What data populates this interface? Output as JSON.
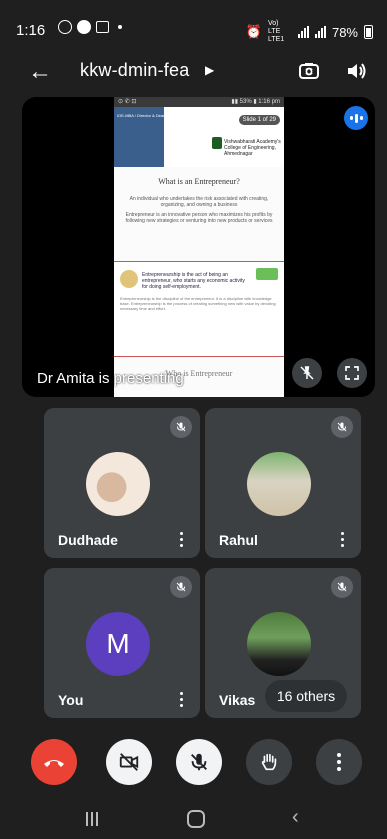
{
  "status_bar": {
    "time": "1:16",
    "network": "Vo) LTE LTE1",
    "battery": "78%"
  },
  "top_bar": {
    "meeting_title": "kkw-dmin-fea",
    "back_icon": "arrow-left-icon",
    "switch_camera_icon": "switch-camera-icon",
    "speaker_icon": "speaker-icon"
  },
  "presentation": {
    "presenter_label": "Dr Amita is presenting",
    "slide_counter": "Slide 1 of 29",
    "slide_header_text": "IOE-MBA / Director & Dean / 23rd February 2021",
    "college_name": "Vishwabharati Academy's College of Engineering, Ahmednagar",
    "slide1_title": "What is an Entrepreneur?",
    "slide1_point1": "An individual who undertakes the risk associated with creating, organizing, and owning a business",
    "slide1_point2": "Entrepreneur is an innovative person who maximizes his profits by following new strategies or venturing into new products or services",
    "slide2_bold": "Entrepreneurship is the act of being an entrepreneur, who starts any economic activity for doing self-employment.",
    "slide2_para": "Entrepreneurship is the discipline of the entrepreneur. It is a discipline with knowledge base. Entrepreneurship is the process of creating something new with value by devoting necessary time and effort.",
    "slide3_title": "Who is Entrepreneur"
  },
  "participants": [
    {
      "name": "Dudhade",
      "avatar": "photo"
    },
    {
      "name": "Rahul",
      "avatar": "photo"
    },
    {
      "name": "You",
      "avatar_letter": "M"
    },
    {
      "name": "Vikas",
      "avatar": "photo"
    }
  ],
  "others_count": "16 others",
  "controls": {
    "end_call": "end-call-icon",
    "camera": "camera-off-icon",
    "mic": "mic-off-icon",
    "raise_hand": "hand-icon",
    "more": "more-vert-icon"
  },
  "colors": {
    "end_call": "#ea4335",
    "you_avatar": "#5b3fbf",
    "meet_blue": "#1a73e8"
  }
}
